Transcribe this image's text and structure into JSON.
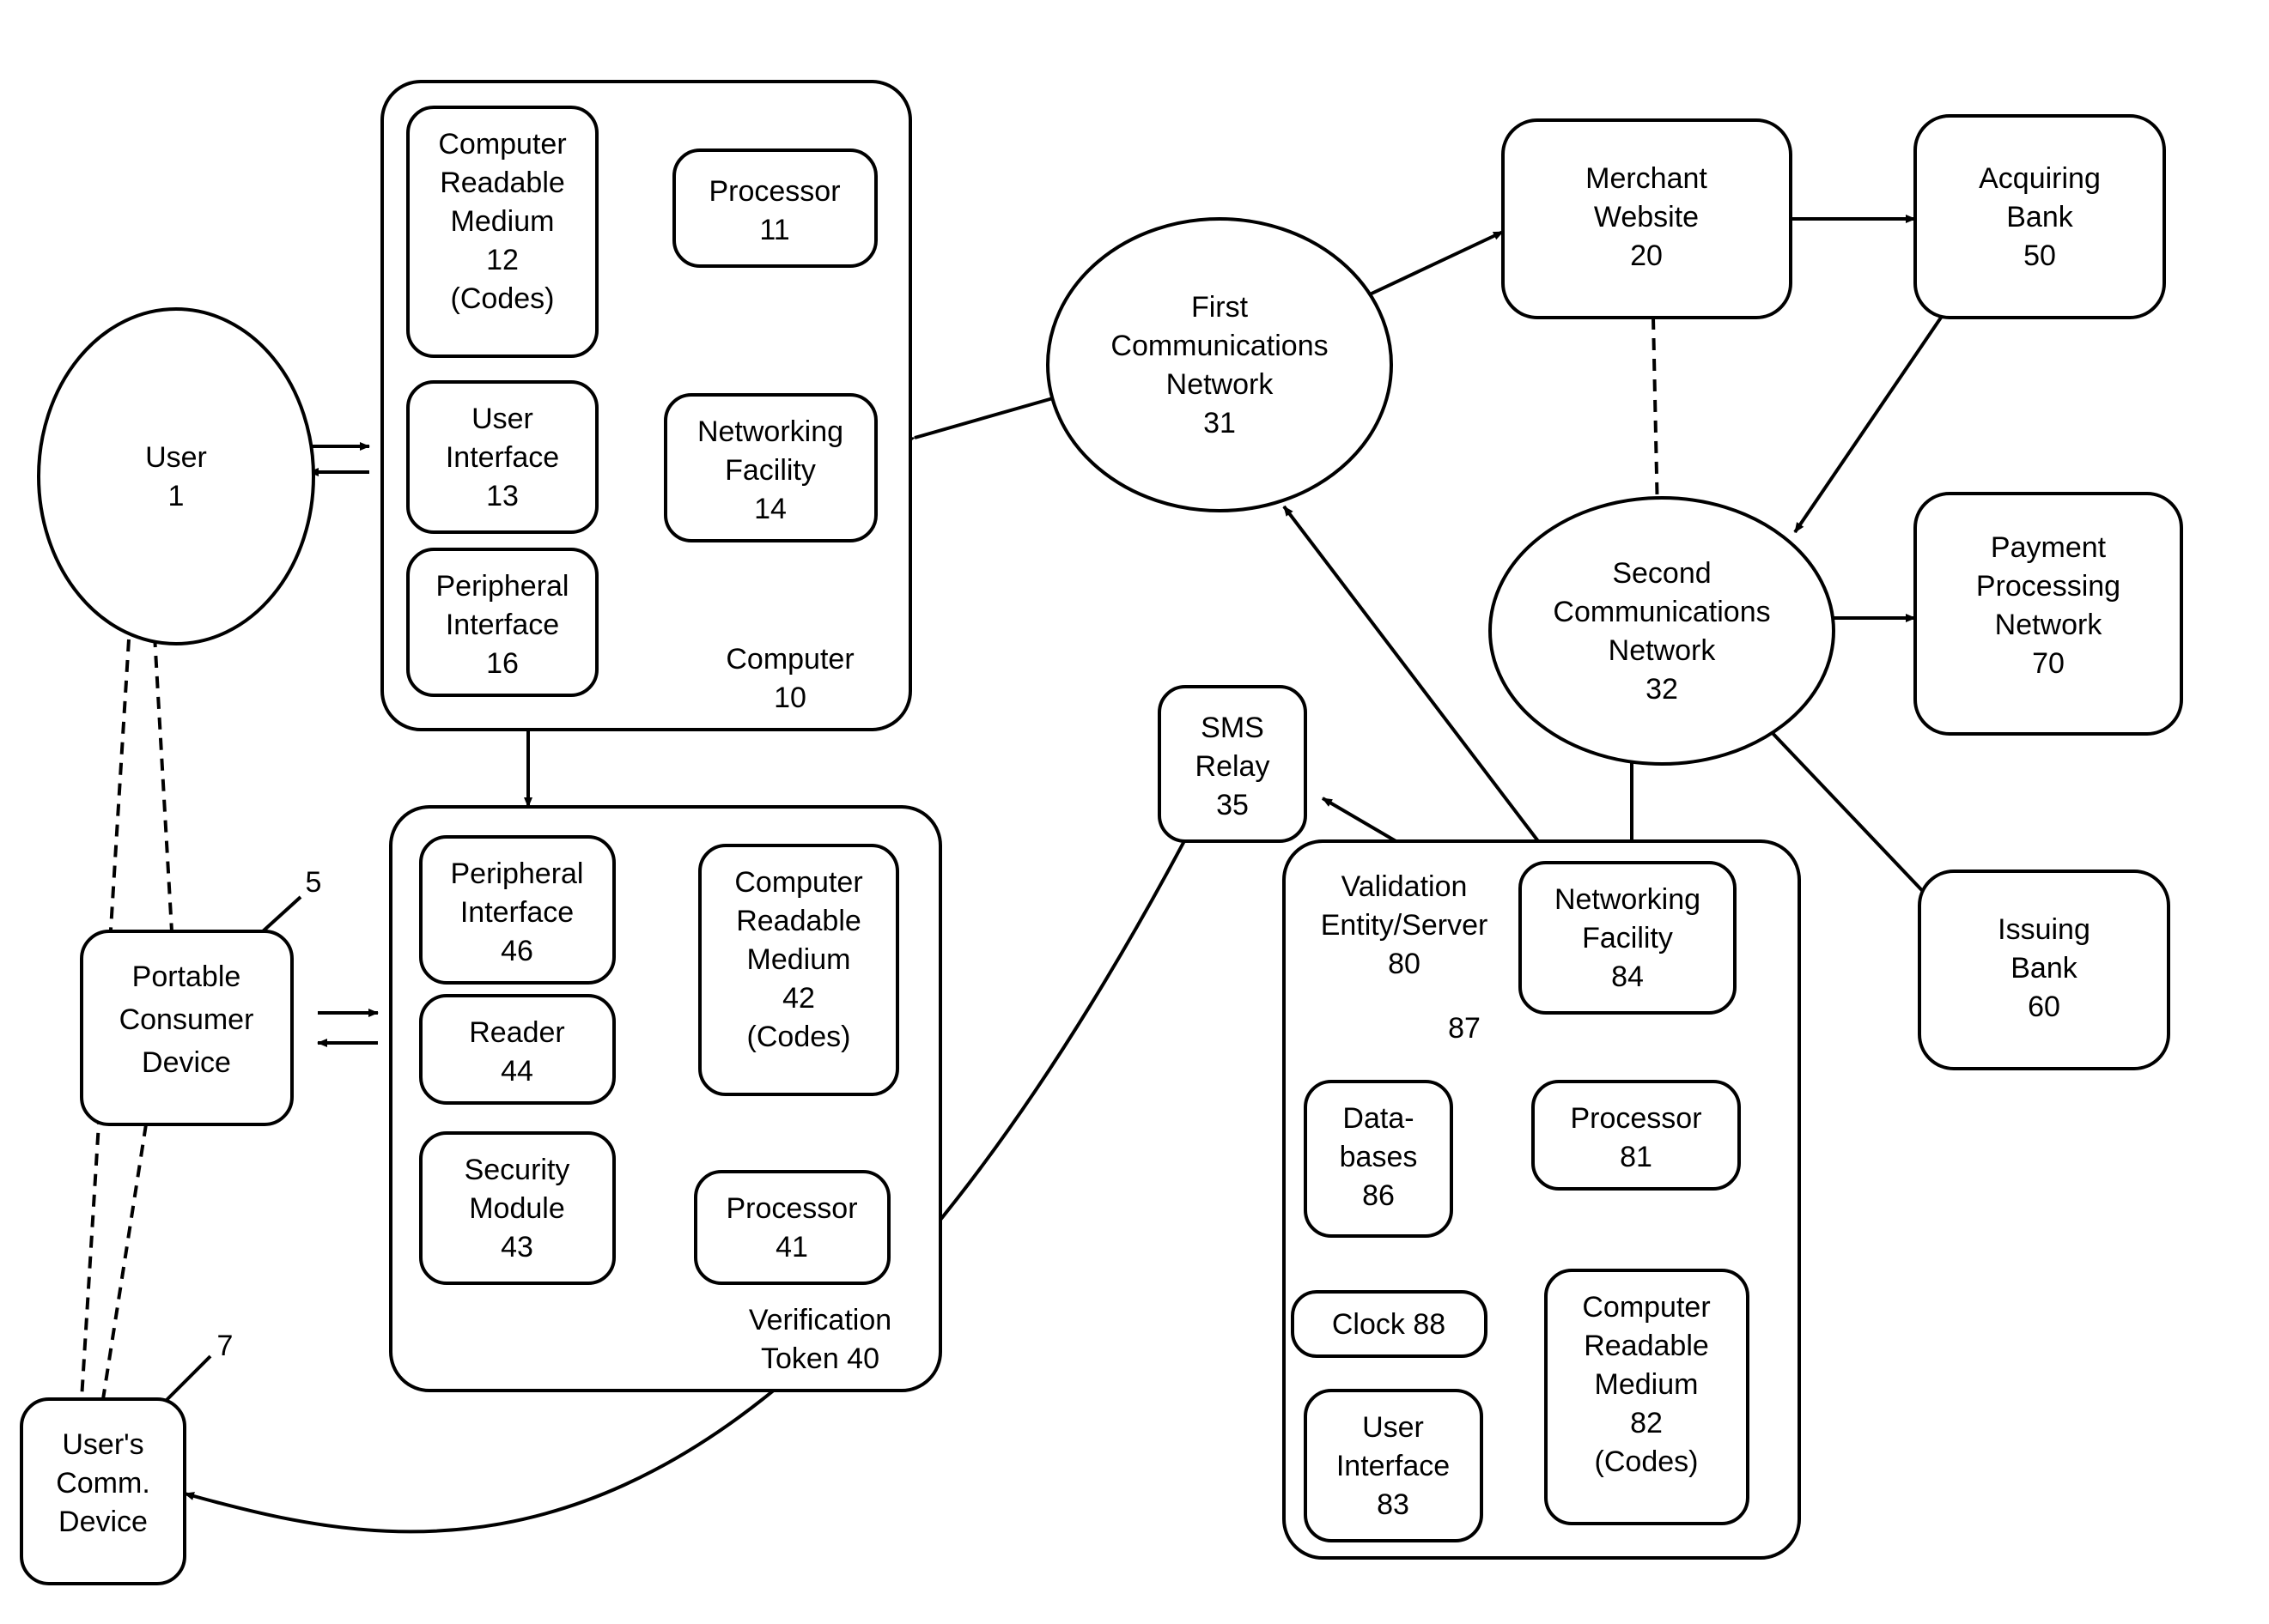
{
  "nodes": {
    "user": [
      "User",
      "1"
    ],
    "pcd": [
      "Portable",
      "Consumer",
      "Device"
    ],
    "ucd": [
      "User's",
      "Comm.",
      "Device"
    ],
    "comp_label": [
      "Computer",
      "10"
    ],
    "crm12": [
      "Computer",
      "Readable",
      "Medium",
      "12",
      "(Codes)"
    ],
    "proc11": [
      "Processor",
      "11"
    ],
    "ui13": [
      "User",
      "Interface",
      "13"
    ],
    "nf14": [
      "Networking",
      "Facility",
      "14"
    ],
    "pi16": [
      "Peripheral",
      "Interface",
      "16"
    ],
    "vt_label": [
      "Verification",
      "Token   40"
    ],
    "pi46": [
      "Peripheral",
      "Interface",
      "46"
    ],
    "crm42": [
      "Computer",
      "Readable",
      "Medium",
      "42",
      "(Codes)"
    ],
    "rd44": [
      "Reader",
      "44"
    ],
    "sm43": [
      "Security",
      "Module",
      "43"
    ],
    "proc41": [
      "Processor",
      "41"
    ],
    "fcn": [
      "First",
      "Communications",
      "Network",
      "31"
    ],
    "scn": [
      "Second",
      "Communications",
      "Network",
      "32"
    ],
    "mw": [
      "Merchant",
      "Website",
      "20"
    ],
    "ab": [
      "Acquiring",
      "Bank",
      "50"
    ],
    "ppn": [
      "Payment",
      "Processing",
      "Network",
      "70"
    ],
    "ib": [
      "Issuing",
      "Bank",
      "60"
    ],
    "sms": [
      "SMS",
      "Relay",
      "35"
    ],
    "ve_label": [
      "Validation",
      "Entity/Server",
      "80"
    ],
    "nf84": [
      "Networking",
      "Facility",
      "84"
    ],
    "proc81": [
      "Processor",
      "81"
    ],
    "db86": [
      "Data-",
      "bases",
      "86"
    ],
    "clk88": [
      "Clock  88"
    ],
    "ui83": [
      "User",
      "Interface",
      "83"
    ],
    "crm82": [
      "Computer",
      "Readable",
      "Medium",
      "82",
      "(Codes)"
    ],
    "ref5": "5",
    "ref7": "7",
    "ref87": "87"
  }
}
